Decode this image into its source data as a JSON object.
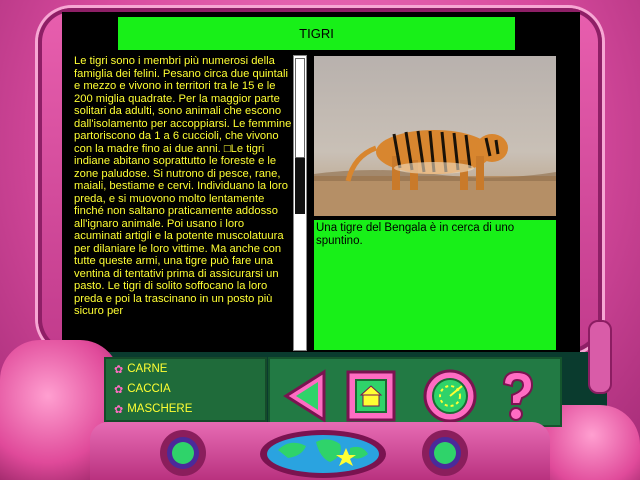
{
  "window": {
    "title": "TIGRI"
  },
  "article": {
    "text": "Le tigri sono i membri più numerosi della famiglia dei felini. Pesano circa due quintali e mezzo e vivono in territori tra le 15 e le 200 miglia quadrate. Per la maggior parte solitari da adulti, sono animali che escono dall'isolamento per accoppiarsi. Le femmine partoriscono da 1 a 6 cuccioli, che vivono con la madre fino ai due anni. □Le tigri indiane abitano soprattutto le foreste e le zone paludose. Si nutrono di pesce, rane, maiali, bestiame e cervi. Individuano la loro preda, e si muovono molto lentamente finché non saltano praticamente addosso all'ignaro animale. Poi usano i loro acuminati artigli e la potente muscolatuura per dilaniare le loro vittime. Ma anche con tutte queste armi, una tigre può fare una ventina di tentativi prima di assicurarsi un pasto. Le tigri di solito soffocano la loro preda e poi la trascinano in un posto più sicuro per",
    "scroll_position": 0.0
  },
  "photo": {
    "caption": "Una tigre del Bengala è in cerca di uno spuntino."
  },
  "menu": {
    "items": [
      {
        "label": "CARNE"
      },
      {
        "label": "CACCIA"
      },
      {
        "label": "MASCHERE"
      }
    ]
  },
  "controls": {
    "back": {
      "icon": "triangle-left-icon"
    },
    "home": {
      "icon": "house-icon"
    },
    "radar": {
      "icon": "radar-icon"
    },
    "help": {
      "icon": "question-mark-icon"
    }
  },
  "colors": {
    "accent_green": "#18f018",
    "text_yellow": "#ffff33",
    "frame_pink": "#e04a9a"
  }
}
